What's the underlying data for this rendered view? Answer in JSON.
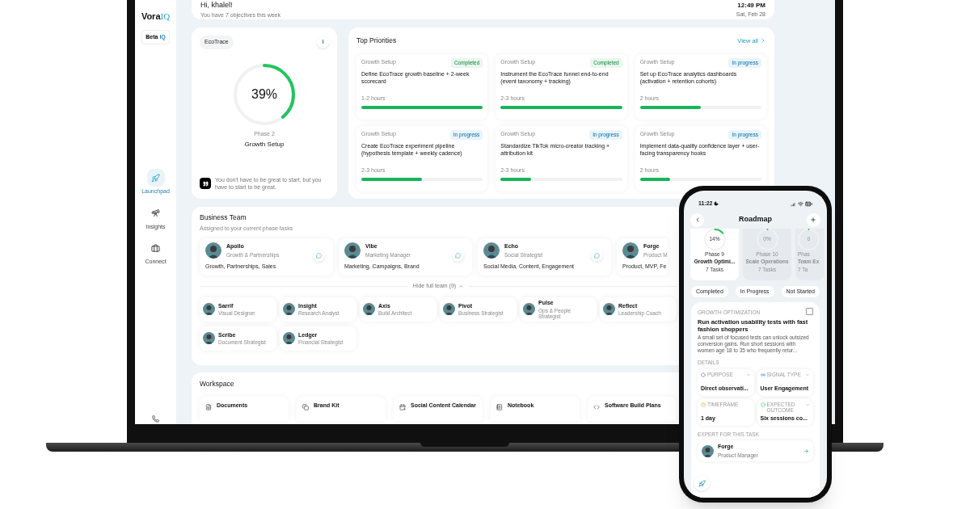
{
  "sidebar": {
    "logo": {
      "main": "Vora",
      "accent": "IQ"
    },
    "badge": {
      "main": "Beta",
      "accent": "IQ"
    },
    "items": [
      {
        "label": "Launchpad",
        "selected": true
      },
      {
        "label": "Insights",
        "selected": false
      },
      {
        "label": "Connect",
        "selected": false
      }
    ]
  },
  "header": {
    "greeting": "Hi, khalel!",
    "prefix": "You have",
    "count": "7",
    "suffix": "objectives this week",
    "time": "12:49 PM",
    "date": "Sat, Feb 28"
  },
  "project": {
    "name": "EcoTrace",
    "info": "i",
    "level": 0.39,
    "percent": "39%",
    "phase": "Phase 2",
    "phase_name": "Growth Setup",
    "quote": "You don't have to be great to start, but you have to start to be great."
  },
  "priorities": {
    "title": "Top Priorities",
    "view_all": "View all",
    "tasks": [
      {
        "category": "Growth Setup",
        "status": {
          "kind": "completed",
          "label": "Completed"
        },
        "title": "Define EcoTrace growth baseline + 2-week scorecard",
        "duration": "1-2 hours",
        "level": 1
      },
      {
        "category": "Growth Setup",
        "status": {
          "kind": "completed",
          "label": "Completed"
        },
        "title": "Instrument the EcoTrace funnel end-to-end (event taxonomy + tracking)",
        "duration": "2-3 hours",
        "level": 1
      },
      {
        "category": "Growth Setup",
        "status": {
          "kind": "in_progress",
          "label": "In progress"
        },
        "title": "Set up EcoTrace analytics dashboards (activation + retention cohorts)",
        "duration": "2 hours",
        "level": 0.5
      },
      {
        "category": "Growth Setup",
        "status": {
          "kind": "in_progress",
          "label": "In progress"
        },
        "title": "Create EcoTrace experiment pipeline (hypothesis template + weekly cadence)",
        "duration": "2-3 hours",
        "level": 0.5
      },
      {
        "category": "Growth Setup",
        "status": {
          "kind": "in_progress",
          "label": "In progress"
        },
        "title": "Standardize TikTok micro-creator tracking + attribution kit",
        "duration": "2-3 hours",
        "level": 0.25
      },
      {
        "category": "Growth Setup",
        "status": {
          "kind": "in_progress",
          "label": "In progress"
        },
        "title": "Implement data-quality confidence layer + user-facing transparency hooks",
        "duration": "2 hours",
        "level": 0.25
      }
    ]
  },
  "team": {
    "title": "Business Team",
    "subtitle": "Assigned to your current phase tasks",
    "leads": [
      {
        "name": "Apollo",
        "role": "Growth & Partnerships",
        "skills": "Growth, Partnerships, Sales"
      },
      {
        "name": "Vibe",
        "role": "Marketing Manager",
        "skills": "Marketing, Campaigns, Brand"
      },
      {
        "name": "Echo",
        "role": "Social Strategist",
        "skills": "Social Media, Content, Engagement"
      },
      {
        "name": "Forge",
        "role": "Product M",
        "skills": "Product, MVP, Fe"
      }
    ],
    "toggle": "Hide full team (9)",
    "members": [
      {
        "name": "Sarrif",
        "role": "Visual Designer"
      },
      {
        "name": "Insight",
        "role": "Research Analyst"
      },
      {
        "name": "Axis",
        "role": "Build Architect"
      },
      {
        "name": "Pivot",
        "role": "Business Strategist"
      },
      {
        "name": "Pulse",
        "role": "Ops & People Strategist"
      },
      {
        "name": "Reflect",
        "role": "Leadership Coach"
      },
      {
        "name": "Scribe",
        "role": "Document Strategist"
      },
      {
        "name": "Ledger",
        "role": "Financial Strategist"
      }
    ]
  },
  "workspace": {
    "title": "Workspace",
    "items": [
      {
        "name": "Documents"
      },
      {
        "name": "Brand Kit"
      },
      {
        "name": "Social Content Calendar"
      },
      {
        "name": "Notebook"
      },
      {
        "name": "Software Build Plans"
      }
    ]
  },
  "phone": {
    "time": "11:22",
    "title": "Roadmap",
    "phases": [
      {
        "percent": "14%",
        "level": 0.14,
        "phase": "Phase 9",
        "name": "Growth Optimi...",
        "tasks": "7 Tasks",
        "selected": true
      },
      {
        "percent": "0%",
        "level": 0,
        "phase": "Phase 10",
        "name": "Scale Operations",
        "tasks": "7 Tasks",
        "selected": false
      },
      {
        "percent": "0",
        "level": 0,
        "phase": "Phas",
        "name": "Team Ex",
        "tasks": "7 Ta",
        "selected": false
      }
    ],
    "filters": [
      "Completed",
      "In Progress",
      "Not Started"
    ],
    "task": {
      "category": "GROWTH OPTIMIZATION",
      "checked": false,
      "title": "Run activation usability tests with fast fashion shoppers",
      "description": "A small set of focused tests can unlock outsized conversion gains. Run short sessions with women age 18 to 35 who frequently retur...",
      "details_label": "DETAILS",
      "details": [
        {
          "label": "PURPOSE",
          "value": "Direct observati...",
          "dropdown": true
        },
        {
          "label": "SIGNAL TYPE",
          "value": "User Engagement",
          "dropdown": true
        },
        {
          "label": "TIMEFRAME",
          "value": "1 day",
          "dropdown": false
        },
        {
          "label": "EXPECTED OUTCOME",
          "value": "Six sessions co...",
          "dropdown": true
        }
      ],
      "expert_label": "EXPERT FOR THIS TASK",
      "expert": {
        "name": "Forge",
        "role": "Product Manager"
      }
    }
  }
}
